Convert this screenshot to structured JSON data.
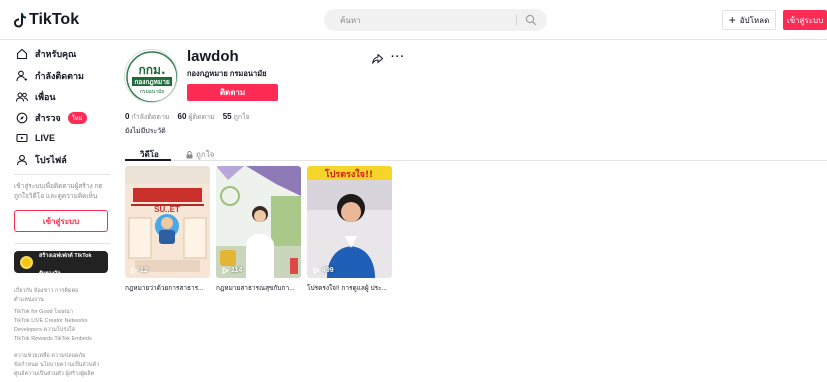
{
  "header": {
    "logo_text": "TikTok",
    "search_placeholder": "ค้นหา",
    "upload_label": "อัปโหลด",
    "upload_plus": "+",
    "login_label": "เข้าสู่ระบบ"
  },
  "sidebar": {
    "items": [
      {
        "label": "สำหรับคุณ",
        "icon": "home-icon"
      },
      {
        "label": "กำลังติดตาม",
        "icon": "following-icon"
      },
      {
        "label": "เพื่อน",
        "icon": "friends-icon"
      },
      {
        "label": "สำรวจ",
        "icon": "explore-icon",
        "badge": "ใหม่"
      },
      {
        "label": "LIVE",
        "icon": "live-icon"
      },
      {
        "label": "โปรไฟล์",
        "icon": "profile-icon"
      }
    ],
    "login_hint": "เข้าสู่ระบบเพื่อติดตามผู้สร้าง กดถูกใจวิดีโอ และดูความคิดเห็น",
    "login_button": "เข้าสู่ระบบ",
    "effect_card": {
      "line1": "สร้างเอฟเฟกต์ TikTok",
      "line2": "รับรางวัล"
    },
    "footer": [
      "เกี่ยวกับ ห้องข่าว การติดต่อ",
      "ตำแหน่งงาน",
      "TikTok for Good โฆษณา",
      "TikTok LIVE Creator Networks",
      "Developers ความโปร่งใส",
      "TikTok Rewards TikTok Embeds",
      "ความช่วยเหลือ ความปลอดภัย",
      "ข้อกำหนด นโยบายความเป็นส่วนตัว",
      "ศูนย์ความเป็นส่วนตัว ผู้สร้างผู้ผลิต"
    ]
  },
  "profile": {
    "username": "lawdoh",
    "nickname": "กองกฎหมาย กรมอนามัย",
    "avatar_text_1": "กกม.",
    "avatar_text_2": "กองกฎหมาย",
    "avatar_text_3": "กรมอนามัย",
    "follow_label": "ติดตาม",
    "more_label": "···",
    "stats": [
      {
        "value": "0",
        "label": "กำลังติดตาม"
      },
      {
        "value": "60",
        "label": "ผู้ติดตาม"
      },
      {
        "value": "55",
        "label": "ถูกใจ"
      }
    ],
    "bio": "ยังไม่มีประวัติ"
  },
  "tabs": {
    "videos": "วิดีโอ",
    "liked": "ถูกใจ"
  },
  "videos": [
    {
      "views": "12",
      "caption": "กฎหมายว่าด้วยการสาธาร...",
      "thumb_text": "SU..ET"
    },
    {
      "views": "114",
      "caption": "กฎหมายสาธารณสุขกับกา...",
      "thumb_text": ""
    },
    {
      "views": "499",
      "caption": "โปรตรงใจ!! การดูแลผู้ ประ...",
      "thumb_text": "โปรตรงใจ!!"
    }
  ],
  "colors": {
    "accent": "#fe2c55",
    "text": "#161823",
    "muted": "#8a8b91",
    "logo_green": "#1e6b3a"
  }
}
